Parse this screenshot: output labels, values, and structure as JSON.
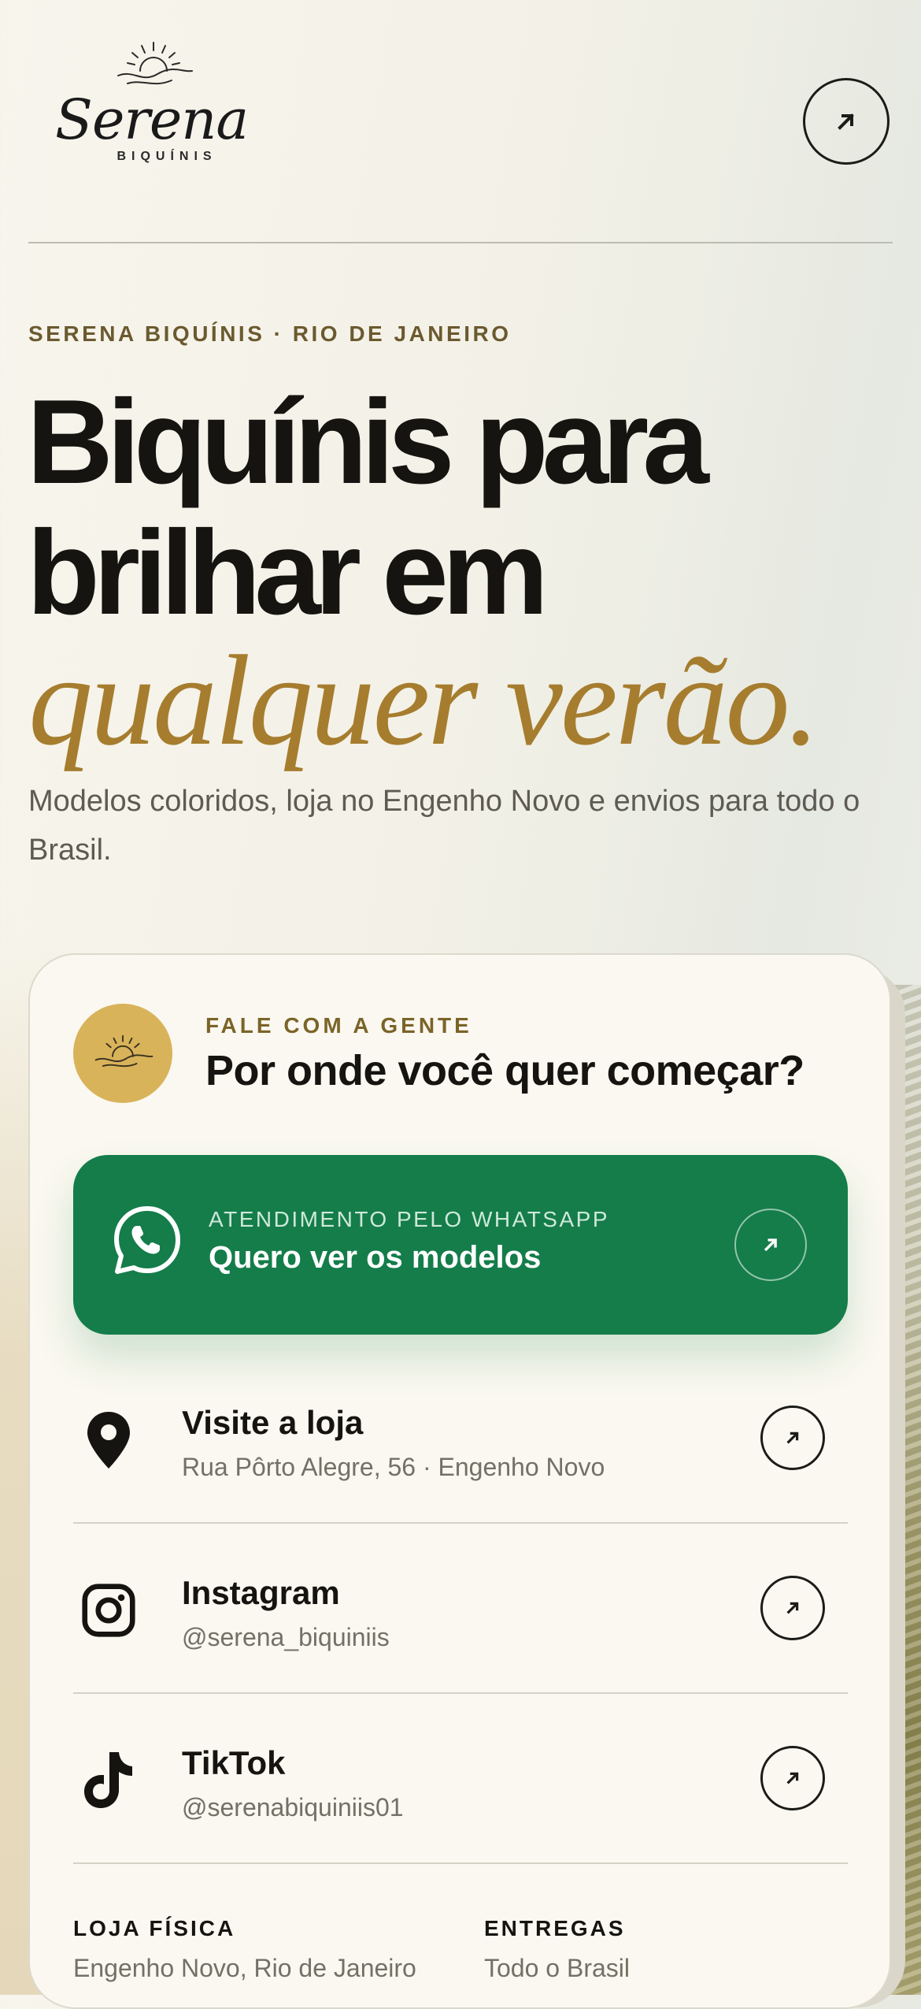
{
  "header": {
    "logo_word": "Serena",
    "logo_sub": "BIQUÍNIS",
    "top_action_icon": "arrow-up-right-icon"
  },
  "hero": {
    "eyebrow": "SERENA BIQUÍNIS · RIO DE JANEIRO",
    "title_line1": "Biquínis para",
    "title_line2": "brilhar em",
    "title_accent": "qualquer verão.",
    "subtitle": "Modelos coloridos, loja no Engenho Novo e envios para todo o Brasil."
  },
  "card": {
    "eyebrow": "FALE COM A GENTE",
    "title": "Por onde você quer começar?",
    "whatsapp": {
      "small_label": "ATENDIMENTO PELO WHATSAPP",
      "big_label": "Quero ver os modelos",
      "icon": "whatsapp-icon"
    },
    "links": [
      {
        "title": "Visite a loja",
        "subtitle": "Rua Pôrto Alegre, 56 · Engenho Novo",
        "icon": "map-pin-icon"
      },
      {
        "title": "Instagram",
        "subtitle": "@serena_biquiniis",
        "icon": "instagram-icon"
      },
      {
        "title": "TikTok",
        "subtitle": "@serenabiquiniis01",
        "icon": "tiktok-icon"
      }
    ],
    "footer": {
      "store_label": "LOJA FÍSICA",
      "store_value": "Engenho Novo, Rio de Janeiro",
      "delivery_label": "ENTREGAS",
      "delivery_value": "Todo o Brasil"
    }
  },
  "colors": {
    "accent_gold": "#a67d2e",
    "whatsapp_green": "#147d4a",
    "badge_gold": "#d8b35a",
    "text_dark": "#151410"
  }
}
